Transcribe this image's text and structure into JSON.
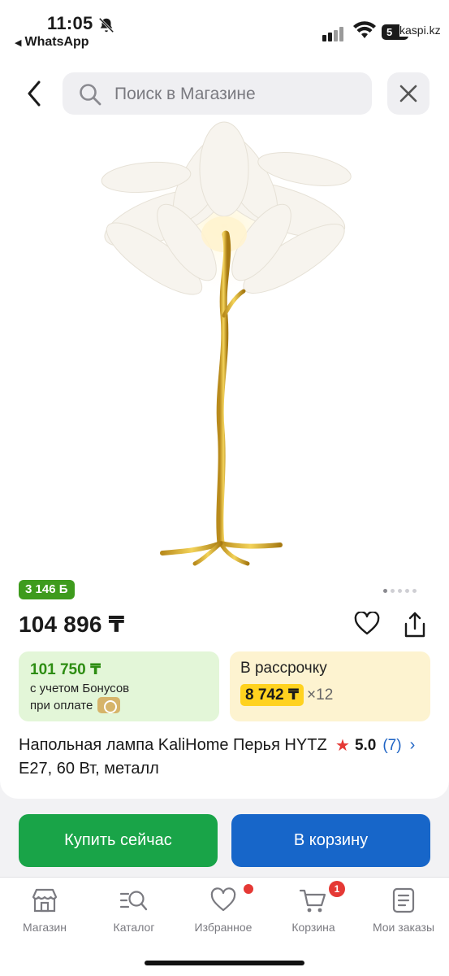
{
  "status_bar": {
    "time": "11:05",
    "back_app": "WhatsApp",
    "battery": "5",
    "url": "kaspi.kz"
  },
  "header": {
    "search_placeholder": "Поиск в Магазине"
  },
  "product": {
    "bonus": "3 146 Б",
    "price": "104 896 ₸",
    "image_count": 5,
    "active_image": 1,
    "bonus_price": "101 750 ₸",
    "bonus_note_line1": "с учетом Бонусов",
    "bonus_note_line2": "при оплате",
    "installment_title": "В рассрочку",
    "installment_price": "8 742 ₸",
    "installment_times": "×12",
    "title": "Напольная лампа KaliHome Перья HYTZ E27, 60 Вт, металл",
    "rating": "5.0",
    "reviews": "(7)"
  },
  "actions": {
    "buy_now": "Купить сейчас",
    "add_to_cart": "В корзину"
  },
  "tabbar": {
    "items": [
      {
        "label": "Магазин",
        "icon": "store-icon"
      },
      {
        "label": "Каталог",
        "icon": "catalog-search-icon"
      },
      {
        "label": "Избранное",
        "icon": "heart-icon"
      },
      {
        "label": "Корзина",
        "icon": "cart-icon",
        "badge": "1"
      },
      {
        "label": "Мои заказы",
        "icon": "orders-icon"
      }
    ]
  },
  "colors": {
    "green_button": "#19a448",
    "blue_button": "#1766c9",
    "bonus_green": "#3e9b1d",
    "installment_yellow": "#ffd21f",
    "badge_red": "#e53935"
  }
}
